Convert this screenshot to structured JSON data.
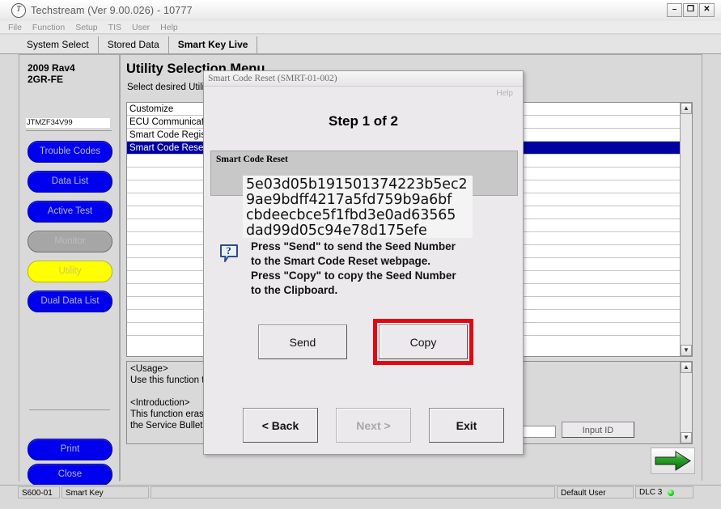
{
  "window": {
    "title": "Techstream (Ver 9.00.026) - 10777",
    "icon": "techstream-logo-icon",
    "controls": {
      "minimize": "–",
      "restore": "❐",
      "close": "✕"
    }
  },
  "menubar": {
    "items": [
      "File",
      "Function",
      "Setup",
      "TIS",
      "User",
      "Help"
    ]
  },
  "tabs": [
    {
      "label": "System Select",
      "active": false
    },
    {
      "label": "Stored Data",
      "active": false
    },
    {
      "label": "Smart Key Live",
      "active": true
    }
  ],
  "sidebar": {
    "vehicle_line1": "2009 Rav4",
    "vehicle_line2": "2GR-FE",
    "vin": "JTMZF34V99",
    "buttons": [
      {
        "label": "Trouble Codes",
        "state": "enabled",
        "color": "#0000ee"
      },
      {
        "label": "Data List",
        "state": "enabled",
        "color": "#0000ee"
      },
      {
        "label": "Active Test",
        "state": "enabled",
        "color": "#0000ee"
      },
      {
        "label": "Monitor",
        "state": "disabled",
        "color": "#a6a6a6"
      },
      {
        "label": "Utility",
        "state": "selected",
        "color": "#ffff00"
      },
      {
        "label": "Dual Data List",
        "state": "enabled",
        "color": "#0000ee"
      }
    ],
    "footer_buttons": [
      {
        "label": "Print",
        "color": "#0000ee"
      },
      {
        "label": "Close",
        "color": "#0000ee"
      }
    ]
  },
  "main": {
    "title": "Utility Selection Menu",
    "subtitle": "Select desired Utility.",
    "list_items": [
      {
        "label": "Customize",
        "selected": false
      },
      {
        "label": "ECU Communication ID Registration",
        "selected": false
      },
      {
        "label": "Smart Code Registration (Diag Mode)",
        "selected": false
      },
      {
        "label": "Smart Code Reset",
        "selected": true
      }
    ],
    "description_lines": [
      "<Usage>",
      "Use this function to reset the smart code.",
      "",
      "<Introduction>",
      "This function erases the registered smart code. For the details see the repair manual or",
      "the Service Bulletin."
    ],
    "next_arrow_icon": "green-right-arrow-icon",
    "background_input_value": "",
    "background_button_label": "Input ID"
  },
  "dialog": {
    "title": "Smart Code Reset (SMRT-01-002)",
    "help_label": "Help",
    "step_label": "Step 1 of 2",
    "group_label": "Smart Code Reset",
    "seed_lines": [
      "5e03d05b191501374223b5ec2",
      "9ae9bdff4217a5fd759b9a6bf",
      "cbdeecbce5f1fbd3e0ad63565",
      "dad99d05c94e78d175efe"
    ],
    "hint_icon": "question-bubble-icon",
    "instruction_lines": [
      "Press \"Send\" to send the Seed Number",
      "to the Smart Code Reset webpage.",
      "Press \"Copy\" to copy the Seed Number",
      "to the Clipboard."
    ],
    "send_label": "Send",
    "copy_label": "Copy",
    "copy_highlight_color": "#e30613",
    "back_label": "< Back",
    "next_label": "Next >",
    "next_state": "disabled",
    "exit_label": "Exit"
  },
  "statusbar": {
    "code": "S600-01",
    "system": "Smart Key",
    "message": "",
    "user": "Default User",
    "connection": "DLC 3",
    "led_color": "#00cc00"
  }
}
